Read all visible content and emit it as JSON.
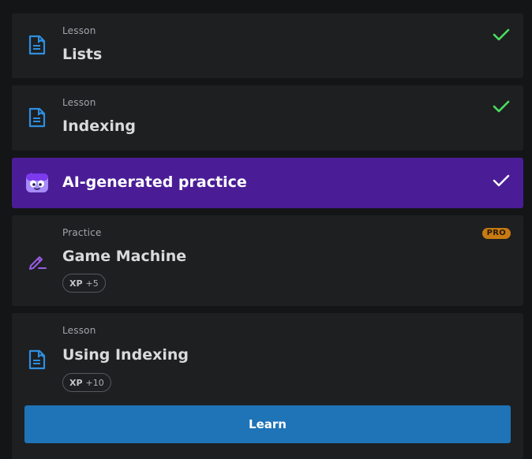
{
  "items": [
    {
      "type_label": "Lesson",
      "title": "Lists",
      "status": "completed",
      "icon": "lesson-doc-icon"
    },
    {
      "type_label": "Lesson",
      "title": "Indexing",
      "status": "completed",
      "icon": "lesson-doc-icon"
    },
    {
      "title": "AI-generated practice",
      "status": "completed",
      "icon": "ai-bot-icon"
    },
    {
      "type_label": "Practice",
      "title": "Game Machine",
      "badge": "PRO",
      "xp_label": "XP",
      "xp_value": "+5",
      "icon": "practice-pencil-icon"
    },
    {
      "type_label": "Lesson",
      "title": "Using Indexing",
      "xp_label": "XP",
      "xp_value": "+10",
      "icon": "lesson-doc-icon",
      "action_label": "Learn"
    }
  ],
  "colors": {
    "background": "#141517",
    "card": "#1e1f21",
    "ai_card": "#4a1d96",
    "check_green": "#4ade5f",
    "lesson_icon_blue": "#2d8fe0",
    "practice_icon_purple": "#9b5de5",
    "pro_badge": "#c77b12",
    "button_blue": "#1f73b7"
  }
}
